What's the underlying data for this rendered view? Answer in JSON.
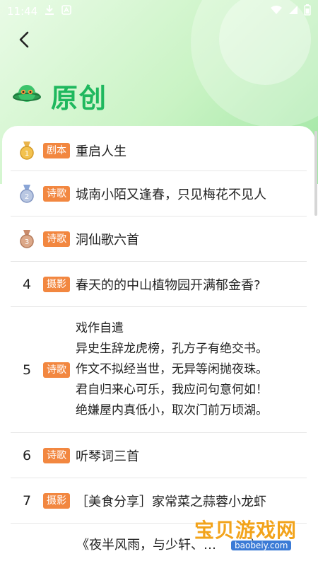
{
  "status_bar": {
    "time": "11:44"
  },
  "header": {
    "title": "原创"
  },
  "items": [
    {
      "rank": "",
      "medal": "gold",
      "tag": "剧本",
      "title": "重启人生"
    },
    {
      "rank": "",
      "medal": "silver",
      "tag": "诗歌",
      "title": "城南小陌又逢春，只见梅花不见人"
    },
    {
      "rank": "",
      "medal": "bronze",
      "tag": "诗歌",
      "title": "洞仙歌六首"
    },
    {
      "rank": "4",
      "tag": "摄影",
      "title": "春天的的中山植物园开满郁金香?"
    },
    {
      "rank": "5",
      "tag": "诗歌",
      "poem": "戏作自遣\n异史生辞龙虎榜，孔方子有绝交书。\n作文不拟经当世，无异等闲抛夜珠。\n君自归来心可乐，我应问句意何如！\n绝嫌屋内真低小，取次门前万顷湖。"
    },
    {
      "rank": "6",
      "tag": "诗歌",
      "title": "听琴词三首"
    },
    {
      "rank": "7",
      "tag": "摄影",
      "title": "［美食分享］家常菜之蒜蓉小龙虾"
    }
  ],
  "partial_item": {
    "title": "《夜半风雨，与少轩、…　　 之…"
  },
  "watermark": {
    "text": "宝贝游戏网",
    "url": "baobeiy.com"
  },
  "colors": {
    "accent": "#1fb85e",
    "tag": "#f28740"
  }
}
